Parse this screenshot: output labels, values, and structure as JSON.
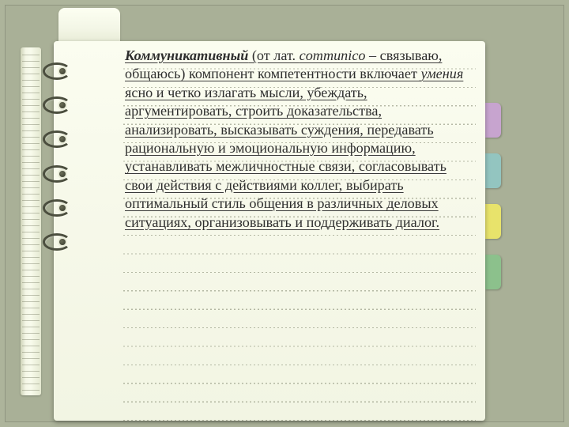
{
  "text": {
    "term": "Коммуникативный",
    "etym_prefix": " (от лат. ",
    "latin": "communico",
    "etym_suffix": " – связываю, общаюсь) компонент компетентности включает ",
    "skills_word": "умения",
    "rest": " ясно и четко излагать мысли, убеждать, аргументировать, строить доказательства, анализировать, высказывать суждения, передавать рациональную и эмоциональную информацию, устанавливать межличностные связи, согласовывать свои действия с действиями коллег, выбирать оптимальный стиль общения в различных деловых ситуациях, организовывать и поддерживать диалог."
  },
  "tabs": {
    "colors": [
      "#c7a4cf",
      "#93c5c0",
      "#e8e36b",
      "#8cc18c"
    ]
  }
}
